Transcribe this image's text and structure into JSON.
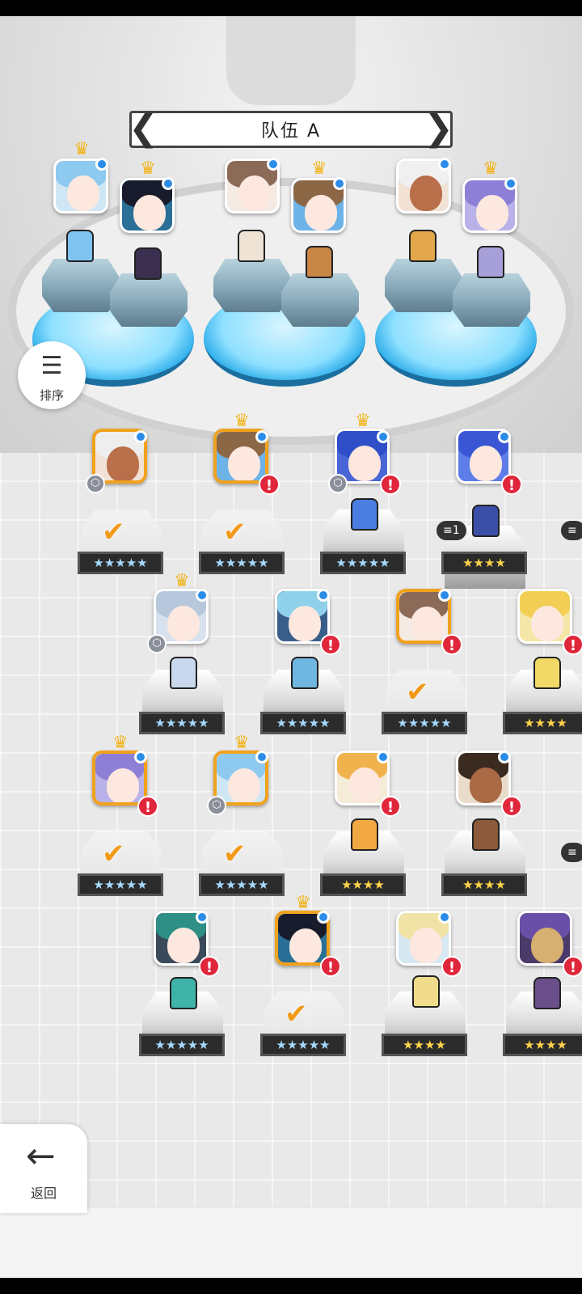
{
  "team": {
    "title": "队伍 A",
    "prev_arrow": "❮",
    "next_arrow": "❯"
  },
  "sort": {
    "label": "排序",
    "icon": "sort-icon"
  },
  "back": {
    "label": "返回",
    "icon": "arrow-left-icon"
  },
  "stars": {
    "five": "★★★★★",
    "four": "★★★★"
  },
  "chips": {
    "a": "1"
  },
  "glyphs": {
    "crown": "♛",
    "alert": "!",
    "check": "✔",
    "cube": "⬡"
  },
  "colors": {
    "selected_border": "#f1a21d",
    "alert": "#e0263b",
    "online_dot": "#2a8ce8",
    "pad_blue": "#1aa3e6"
  }
}
